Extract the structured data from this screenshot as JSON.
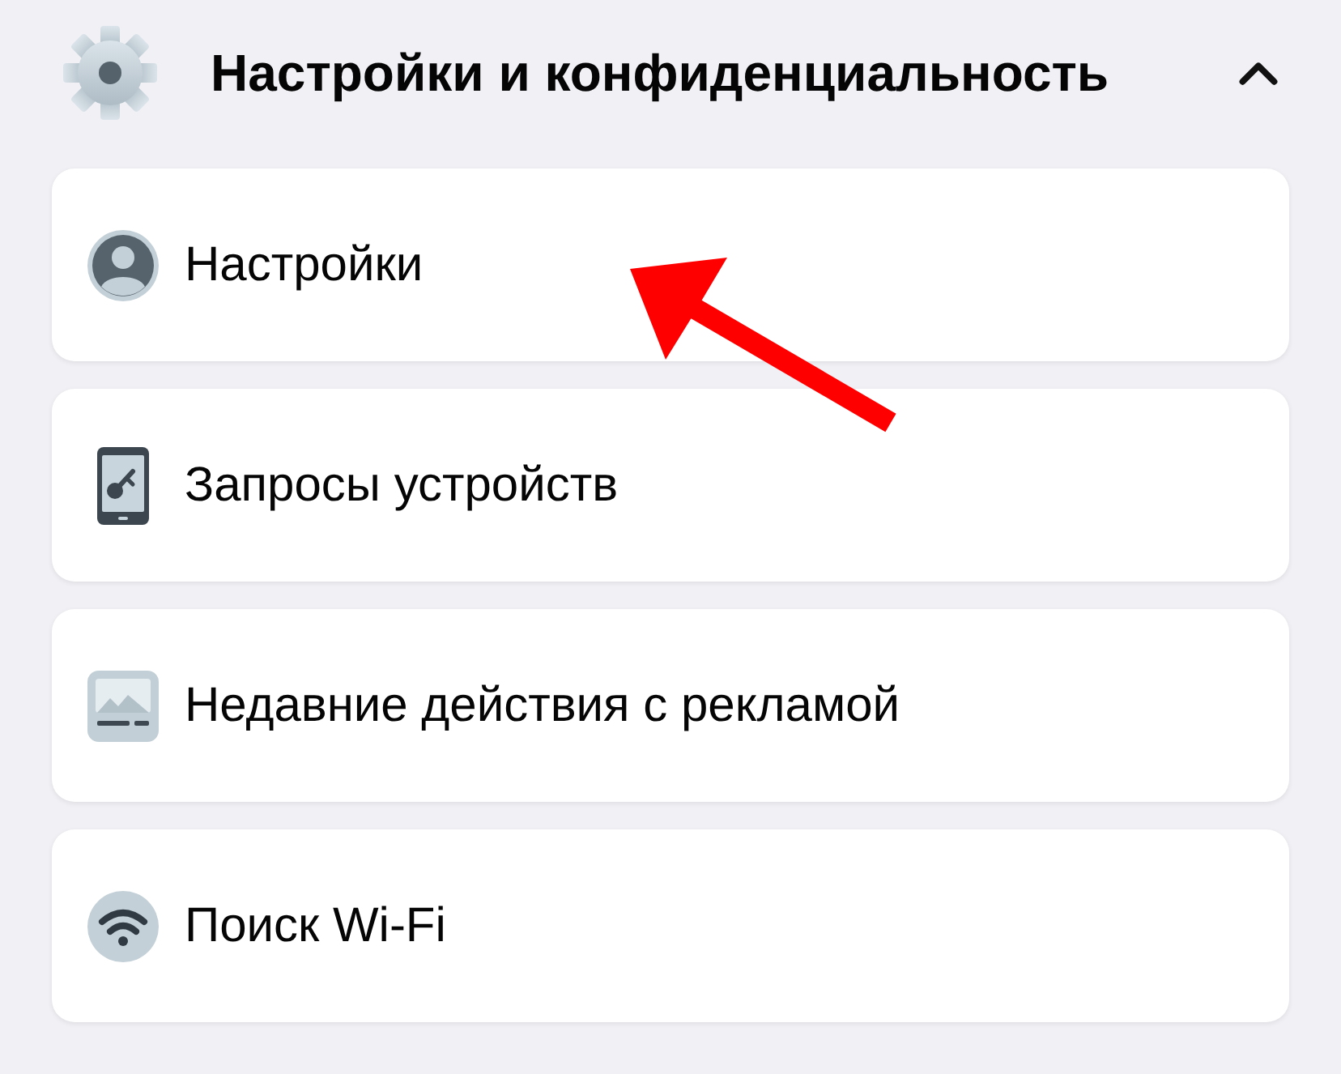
{
  "section": {
    "title": "Настройки и конфиденциальность",
    "expanded": true
  },
  "items": [
    {
      "kind": "profile",
      "label": "Настройки"
    },
    {
      "kind": "phone-key",
      "label": "Запросы устройств"
    },
    {
      "kind": "ad-image",
      "label": "Недавние действия с рекламой"
    },
    {
      "kind": "wifi",
      "label": "Поиск Wi-Fi"
    }
  ]
}
